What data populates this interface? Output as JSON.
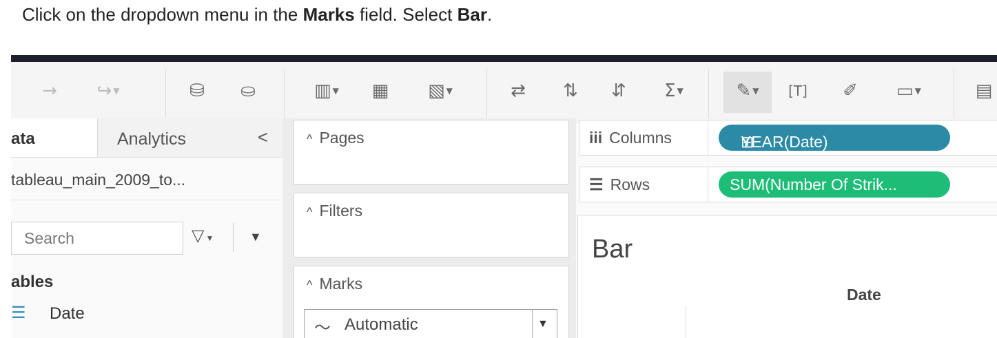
{
  "instruction": {
    "prefix": "Click on the dropdown menu in the ",
    "field": "Marks",
    "middle": " field. Select ",
    "option": "Bar",
    "suffix": "."
  },
  "toolbar": {
    "icons": [
      "redo-arrow-icon",
      "redo-dropdown-icon",
      "new-data-source-icon",
      "pause-data-updates-icon",
      "new-worksheet-icon",
      "duplicate-sheet-icon",
      "clear-sheet-icon",
      "swap-rows-columns-icon",
      "sort-ascending-icon",
      "sort-descending-icon",
      "totals-icon",
      "highlight-icon",
      "show-mark-labels-icon",
      "format-workbook-icon",
      "presentation-mode-icon",
      "show-me-icon"
    ]
  },
  "data_pane": {
    "tab_data": "ata",
    "tab_analytics": "Analytics",
    "collapse": "<",
    "datasource": "tableau_main_2009_to...",
    "search_placeholder": "Search",
    "tables_heading": "ables",
    "fields": [
      "Date"
    ]
  },
  "cards": {
    "pages": "Pages",
    "filters": "Filters",
    "marks": "Marks",
    "marks_type": "Automatic"
  },
  "shelves": {
    "columns_label": "Columns",
    "columns_pill": "YEAR(Date)",
    "rows_label": "Rows",
    "rows_pill": "SUM(Number Of Strik..."
  },
  "viz": {
    "title": "Bar",
    "header": "Date"
  }
}
